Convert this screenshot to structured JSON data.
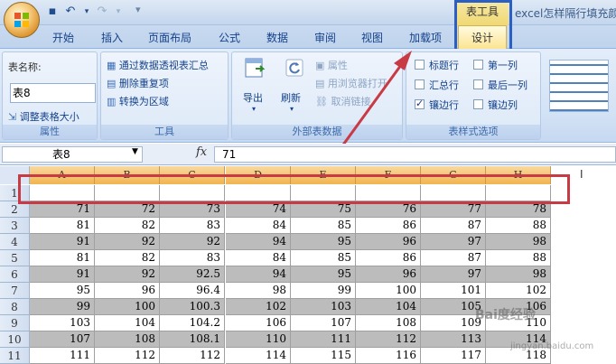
{
  "window": {
    "title": "excel怎样隔行填充颜",
    "context_tab_group": "表工具"
  },
  "tabs": [
    "开始",
    "插入",
    "页面布局",
    "公式",
    "数据",
    "审阅",
    "视图",
    "加载项"
  ],
  "design_tab": "设计",
  "properties": {
    "table_name_label": "表名称:",
    "table_name_value": "表8",
    "resize_label": "调整表格大小",
    "group_label": "属性"
  },
  "tools": {
    "items": [
      "通过数据透视表汇总",
      "删除重复项",
      "转换为区域"
    ],
    "group_label": "工具"
  },
  "external": {
    "export": "导出",
    "refresh": "刷新",
    "properties": "属性",
    "open_browser": "用浏览器打开",
    "unlink": "取消链接",
    "group_label": "外部表数据"
  },
  "style_options": {
    "options": [
      {
        "label": "标题行",
        "checked": false
      },
      {
        "label": "第一列",
        "checked": false
      },
      {
        "label": "汇总行",
        "checked": false
      },
      {
        "label": "最后一列",
        "checked": false
      },
      {
        "label": "镶边行",
        "checked": true
      },
      {
        "label": "镶边列",
        "checked": false
      }
    ],
    "group_label": "表样式选项"
  },
  "formula_bar": {
    "name_box": "表8",
    "fx": "fx",
    "value": "71"
  },
  "sheet": {
    "columns": [
      "A",
      "B",
      "C",
      "D",
      "E",
      "F",
      "G",
      "H"
    ],
    "rows": [
      {
        "num": "1",
        "cells": [
          "",
          "",
          "",
          "",
          "",
          "",
          "",
          ""
        ]
      },
      {
        "num": "2",
        "cells": [
          "71",
          "72",
          "73",
          "74",
          "75",
          "76",
          "77",
          "78"
        ]
      },
      {
        "num": "3",
        "cells": [
          "81",
          "82",
          "83",
          "84",
          "85",
          "86",
          "87",
          "88"
        ]
      },
      {
        "num": "4",
        "cells": [
          "91",
          "92",
          "92",
          "94",
          "95",
          "96",
          "97",
          "98"
        ]
      },
      {
        "num": "5",
        "cells": [
          "81",
          "82",
          "83",
          "84",
          "85",
          "86",
          "87",
          "88"
        ]
      },
      {
        "num": "6",
        "cells": [
          "91",
          "92",
          "92.5",
          "94",
          "95",
          "96",
          "97",
          "98"
        ]
      },
      {
        "num": "7",
        "cells": [
          "95",
          "96",
          "96.4",
          "98",
          "99",
          "100",
          "101",
          "102"
        ]
      },
      {
        "num": "8",
        "cells": [
          "99",
          "100",
          "100.3",
          "102",
          "103",
          "104",
          "105",
          "106"
        ]
      },
      {
        "num": "9",
        "cells": [
          "103",
          "104",
          "104.2",
          "106",
          "107",
          "108",
          "109",
          "110"
        ]
      },
      {
        "num": "10",
        "cells": [
          "107",
          "108",
          "108.1",
          "110",
          "111",
          "112",
          "113",
          "114"
        ]
      },
      {
        "num": "11",
        "cells": [
          "111",
          "112",
          "112",
          "114",
          "115",
          "116",
          "117",
          "118"
        ]
      }
    ]
  },
  "watermark": {
    "main": "Bai度经验",
    "sub": "jingyan.baidu.com"
  },
  "colors": {
    "highlight_blue": "#2c5fc4",
    "annotation_red": "#c83b45",
    "header_orange": "#f2b44f"
  }
}
